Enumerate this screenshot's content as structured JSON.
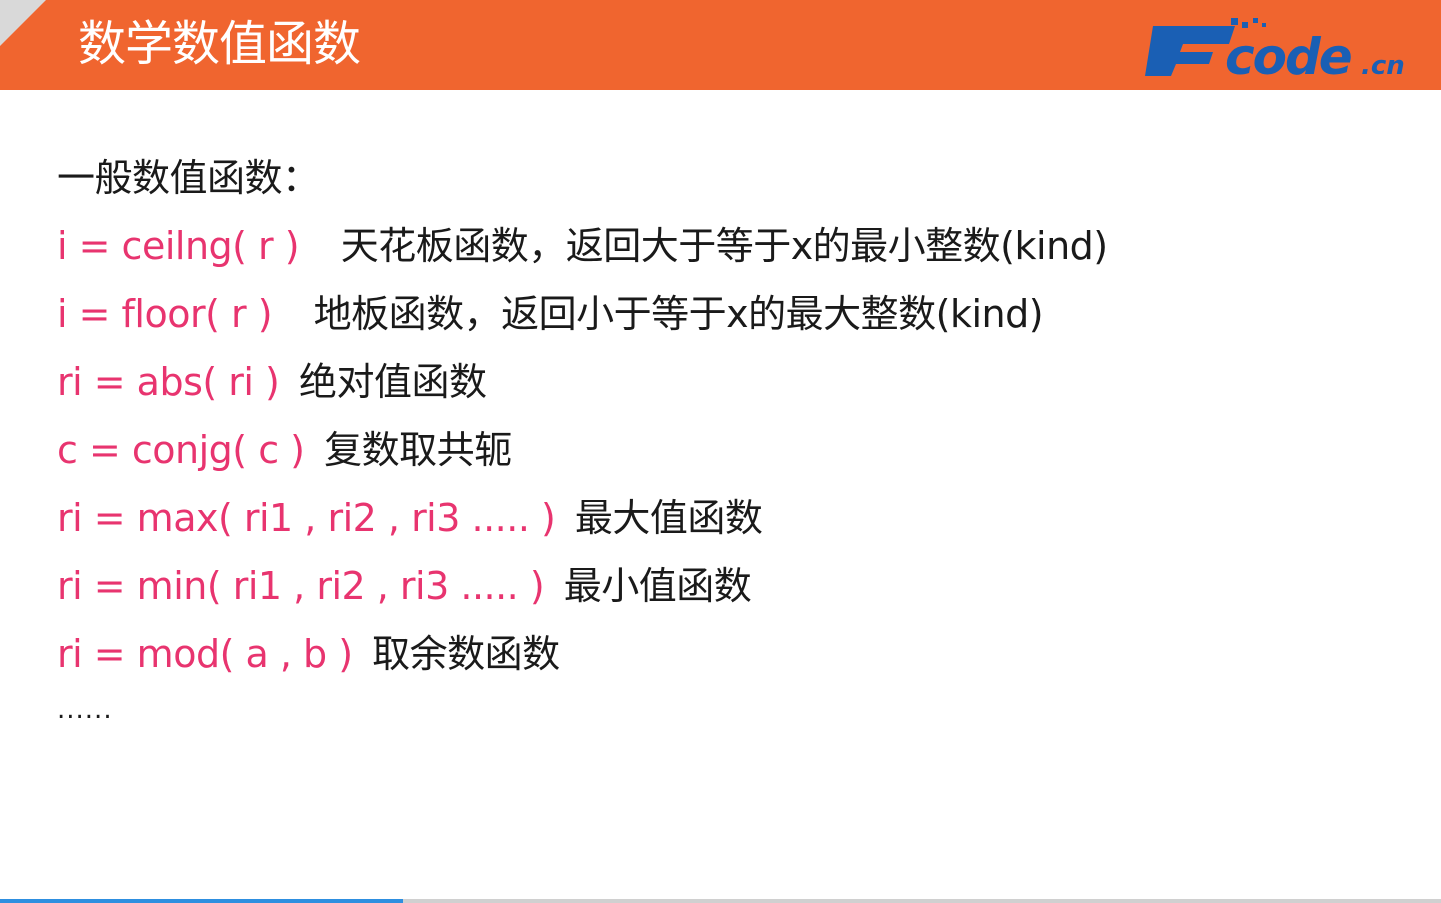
{
  "header": {
    "title": "数学数值函数",
    "background_color": "#f0652f",
    "logo": {
      "text": "Fcode",
      "suffix": ".cn",
      "color": "#1a5fb4"
    }
  },
  "content": {
    "heading": "一般数值函数：",
    "functions": [
      {
        "code": "i = ceilng( r )",
        "description": "天花板函数，返回大于等于x的最小整数(kind)"
      },
      {
        "code": "i = floor( r )",
        "description": "地板函数，返回小于等于x的最大整数(kind)"
      },
      {
        "code": "ri = abs( ri )",
        "description": "绝对值函数"
      },
      {
        "code": "c = conjg( c )",
        "description": "复数取共轭"
      },
      {
        "code": "ri = max( ri1 , ri2 , ri3 ..... )",
        "description": "最大值函数"
      },
      {
        "code": "ri = min( ri1 , ri2 , ri3 ..... )",
        "description": "最小值函数"
      },
      {
        "code": "ri = mod( a , b )",
        "description": "取余数函数"
      }
    ],
    "ellipsis": "......",
    "code_color": "#e8346f"
  },
  "progress": {
    "fraction": 0.28,
    "color": "#2e8fe0"
  }
}
